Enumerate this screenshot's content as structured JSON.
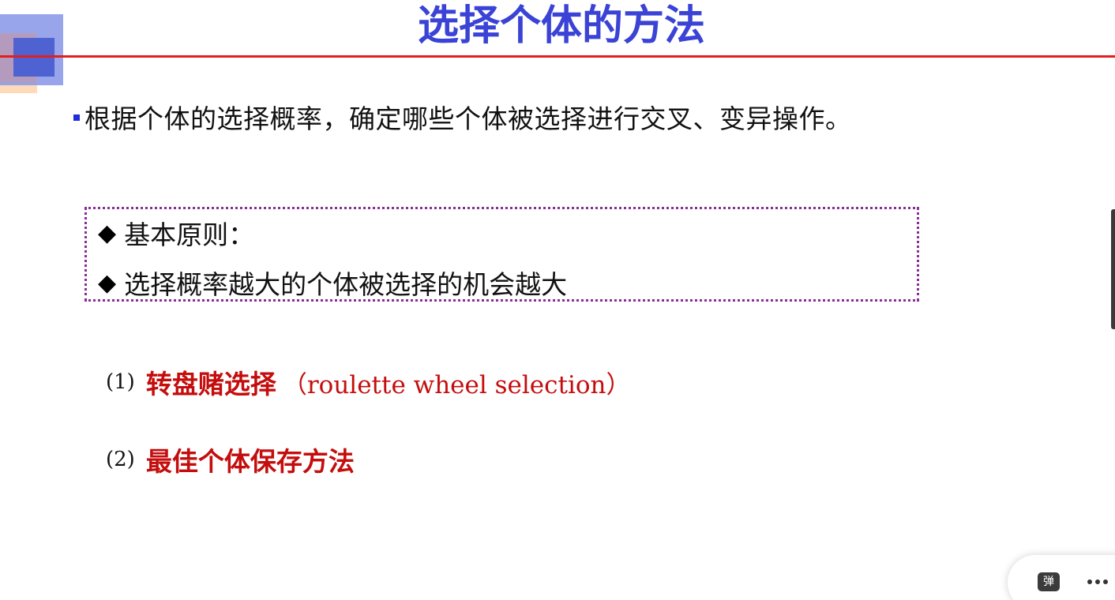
{
  "slide": {
    "title": "选择个体的方法",
    "intro_text": "根据个体的选择概率，确定哪些个体被选择进行交叉、变异操作。",
    "principles": [
      {
        "marker": "◆",
        "text": "基本原则："
      },
      {
        "marker": "◆",
        "text": "选择概率越大的个体被选择的机会越大"
      }
    ],
    "methods": [
      {
        "number": "(1)",
        "name": "转盘赌选择",
        "english": "（roulette wheel selection）"
      },
      {
        "number": "(2)",
        "name": "最佳个体保存方法",
        "english": ""
      }
    ]
  },
  "toolbar": {
    "danmu_label": "弹",
    "more_icon": "more-horizontal-icon"
  },
  "colors": {
    "title": "#3a43d6",
    "rule": "#e41e1e",
    "method_text": "#c40d0d",
    "box_border": "#8a2d98",
    "bullet": "#1f2ed8"
  }
}
